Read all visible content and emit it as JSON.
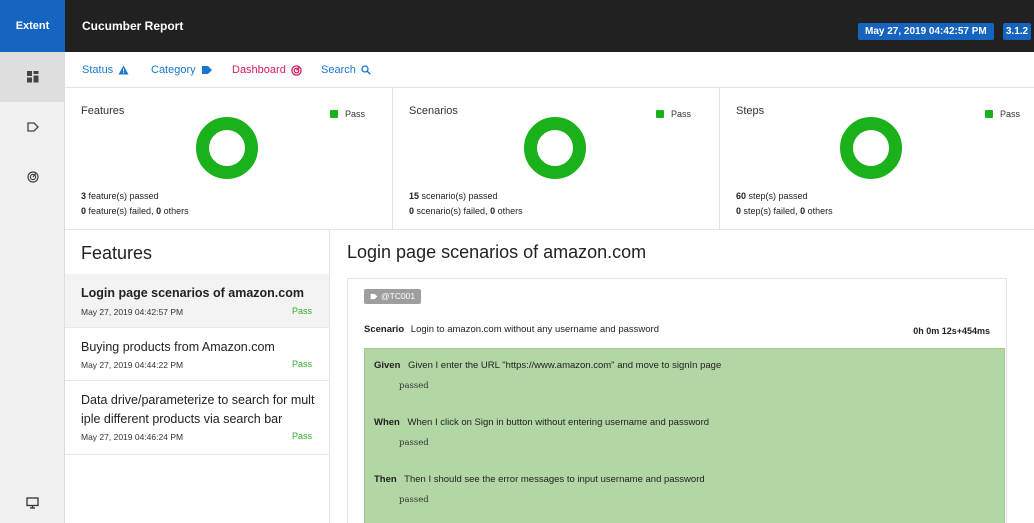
{
  "header": {
    "brand": "Extent",
    "title": "Cucumber Report",
    "date": "May 27, 2019 04:42:57 PM",
    "version": "3.1.2"
  },
  "sidebar": {
    "icons": [
      "dashboard-grid-icon",
      "tag-icon",
      "dashboard-gauge-icon",
      "monitor-icon"
    ]
  },
  "nav": {
    "status": "Status",
    "category": "Category",
    "dashboard": "Dashboard",
    "search": "Search",
    "colors": {
      "link": "#1976d2",
      "dashboard": "#d81b60"
    }
  },
  "dashboard": {
    "cards": [
      {
        "title": "Features",
        "legend": "Pass",
        "passed_count": "3",
        "passed_text": "feature(s) passed",
        "failed_count": "0",
        "failed_text": "feature(s) failed,",
        "others_count": "0",
        "others_text": "others",
        "pass_fraction": 1.0
      },
      {
        "title": "Scenarios",
        "legend": "Pass",
        "passed_count": "15",
        "passed_text": "scenario(s) passed",
        "failed_count": "0",
        "failed_text": "scenario(s) failed,",
        "others_count": "0",
        "others_text": "others",
        "pass_fraction": 1.0
      },
      {
        "title": "Steps",
        "legend": "Pass",
        "passed_count": "60",
        "passed_text": "step(s) passed",
        "failed_count": "0",
        "failed_text": "step(s) failed,",
        "others_count": "0",
        "others_text": "others",
        "pass_fraction": 1.0
      }
    ],
    "pass_color": "#1ab11a"
  },
  "features": {
    "heading": "Features",
    "items": [
      {
        "name": "Login page scenarios of amazon.com",
        "time": "May 27, 2019 04:42:57 PM",
        "status": "Pass"
      },
      {
        "name": "Buying products from Amazon.com",
        "time": "May 27, 2019 04:44:22 PM",
        "status": "Pass"
      },
      {
        "name_line1": "Data drive/parameterize to search for mult",
        "name_line2": "iple different products via search bar",
        "time": "May 27, 2019 04:46:24 PM",
        "status": "Pass"
      }
    ]
  },
  "detail": {
    "title": "Login page scenarios of amazon.com",
    "tag": "@TC001",
    "scenario_keyword": "Scenario",
    "scenario_name": "Login to amazon.com without any username and password",
    "duration": "0h 0m 12s+454ms",
    "steps": [
      {
        "keyword": "Given",
        "text": "Given I enter the URL \"https://www.amazon.com\" and move to signIn page",
        "result": "passed"
      },
      {
        "keyword": "When",
        "text": "When I click on Sign in button without entering username and password",
        "result": "passed"
      },
      {
        "keyword": "Then",
        "text": "Then I should see the error messages to input username and password",
        "result": "passed"
      }
    ],
    "step_pass_bg": "#b2d6a4"
  }
}
